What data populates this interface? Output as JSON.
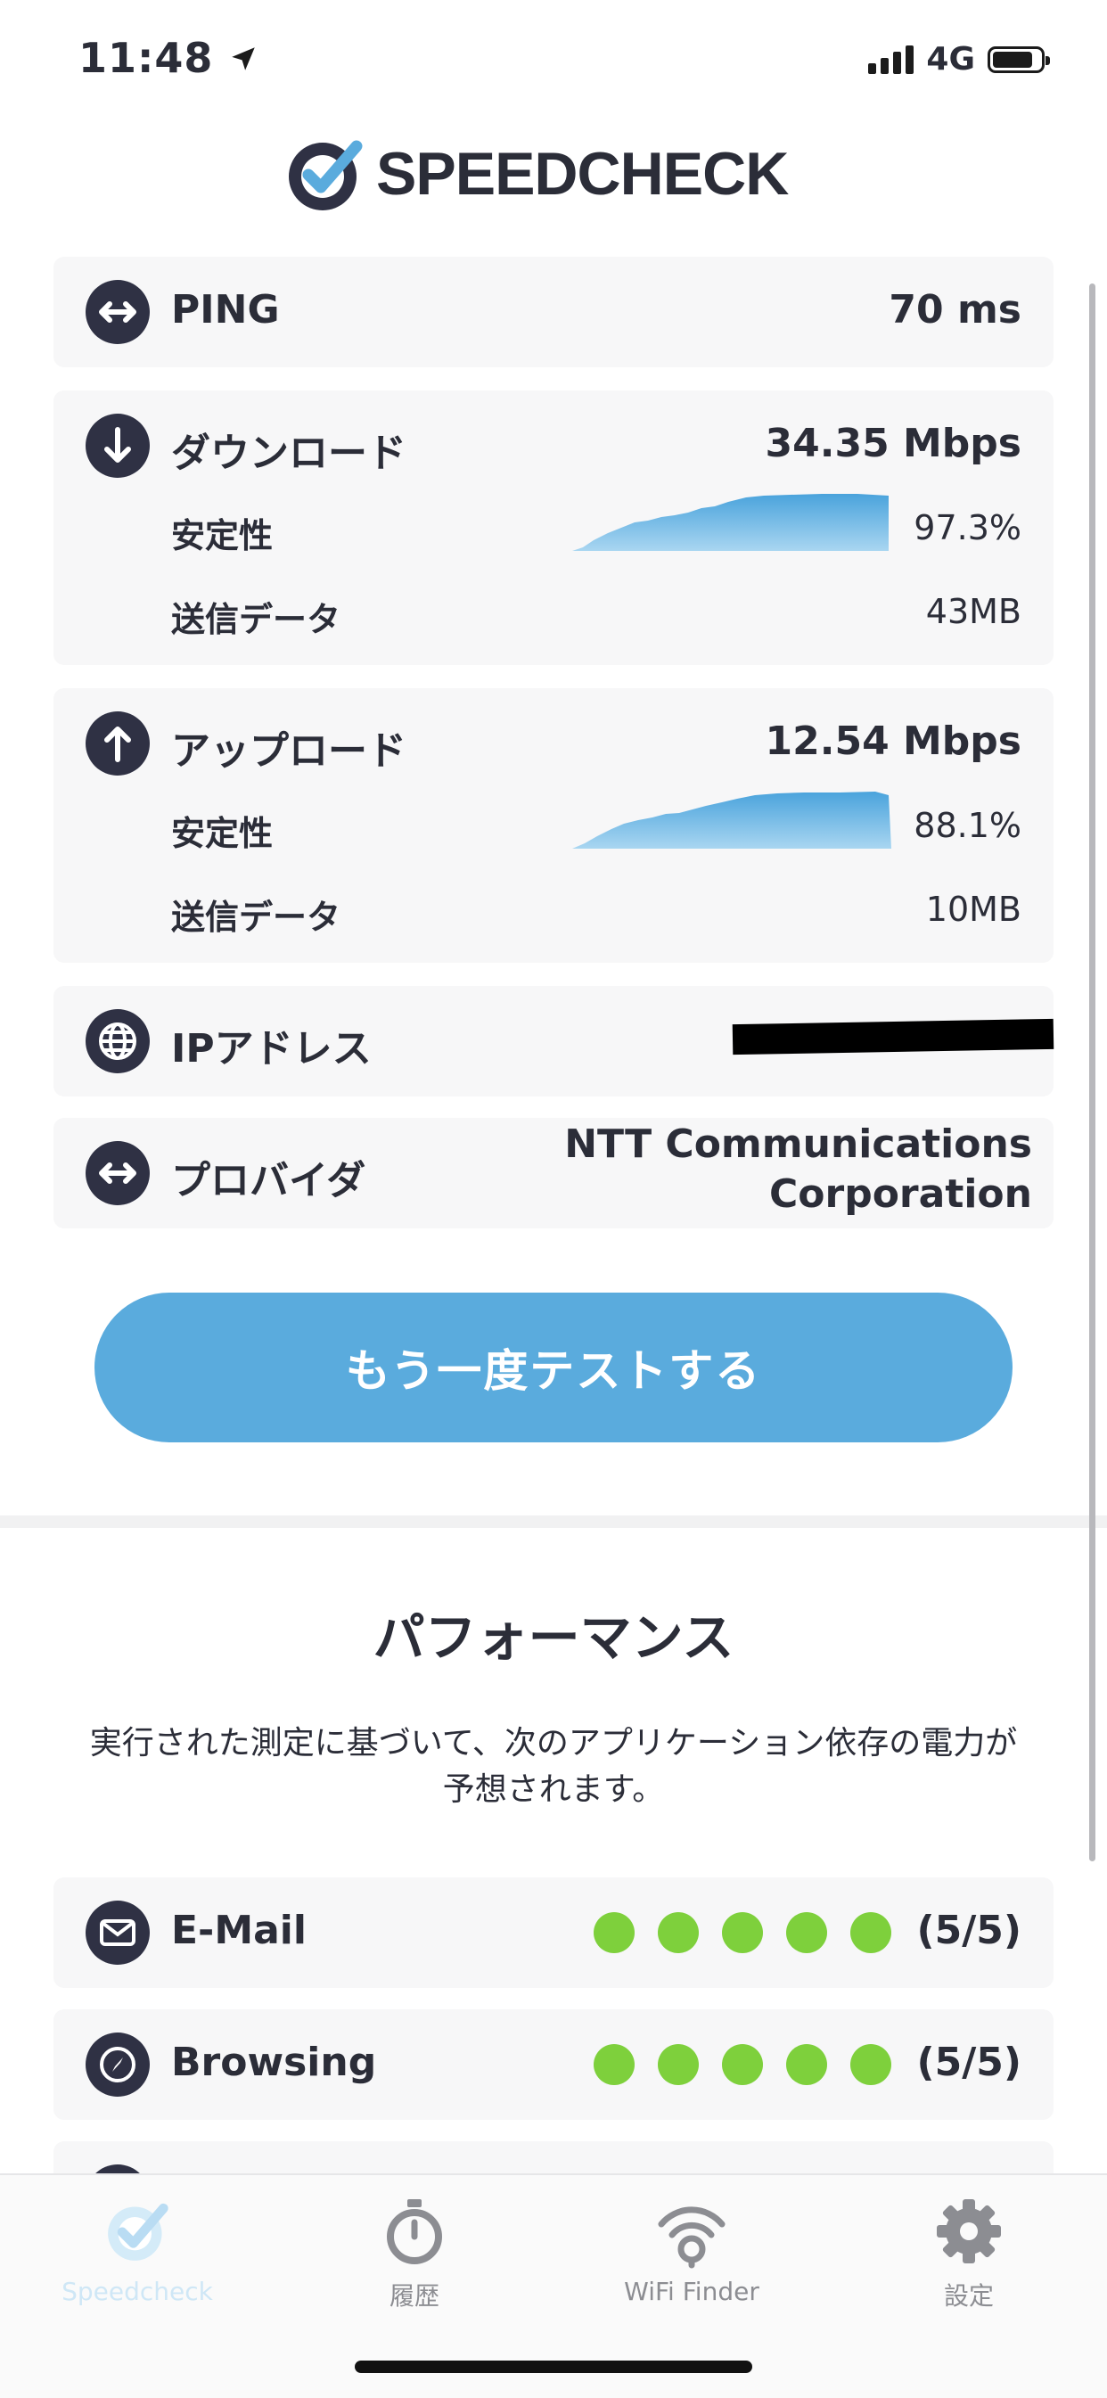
{
  "status_bar": {
    "time": "11:48",
    "network": "4G"
  },
  "app": {
    "logo_text": "SPEEDCHECK"
  },
  "ping": {
    "label": "PING",
    "value": "70 ms"
  },
  "download": {
    "label": "ダウンロード",
    "value": "34.35 Mbps",
    "stability_label": "安定性",
    "stability_value": "97.3%",
    "data_label": "送信データ",
    "data_value": "43MB"
  },
  "upload": {
    "label": "アップロード",
    "value": "12.54 Mbps",
    "stability_label": "安定性",
    "stability_value": "88.1%",
    "data_label": "送信データ",
    "data_value": "10MB"
  },
  "ip": {
    "label": "IPアドレス"
  },
  "provider": {
    "label": "プロバイダ",
    "value_line1": "NTT Communications",
    "value_line2": "Corporation"
  },
  "retest_button": "もう一度テストする",
  "performance": {
    "title": "パフォーマンス",
    "description_line1": "実行された測定に基づいて、次のアプリケーション依存の電力が",
    "description_line2": "予想されます。",
    "items": [
      {
        "label": "E-Mail",
        "rating": "(5/5)",
        "score": 5
      },
      {
        "label": "Browsing",
        "rating": "(5/5)",
        "score": 5
      }
    ]
  },
  "tabs": [
    {
      "label": "Speedcheck",
      "icon": "speedcheck-logo-icon",
      "active": true
    },
    {
      "label": "履歴",
      "icon": "stopwatch-icon"
    },
    {
      "label": "WiFi Finder",
      "icon": "wifi-finder-icon"
    },
    {
      "label": "設定",
      "icon": "gear-icon"
    }
  ],
  "colors": {
    "accent": "#5aabdd",
    "dark": "#2f3144",
    "rating_dot": "#7ed03c",
    "active_tab": "#d4ebf8"
  }
}
